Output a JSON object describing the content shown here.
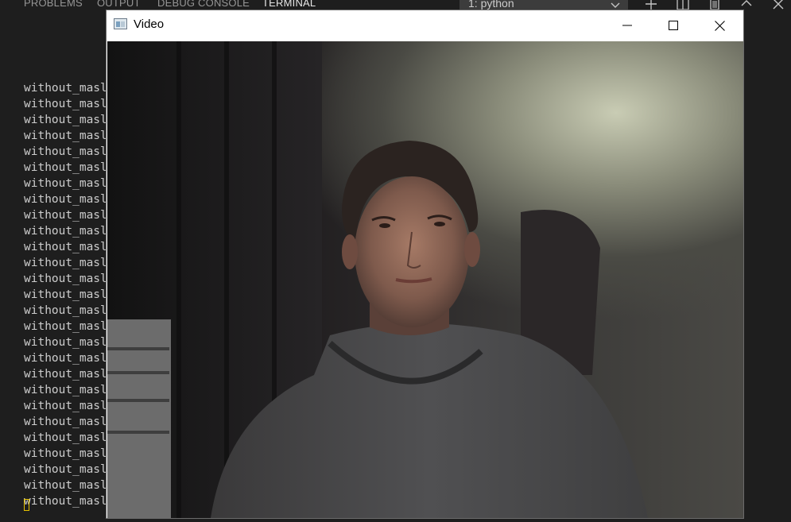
{
  "panel": {
    "tabs": [
      {
        "label": "PROBLEMS"
      },
      {
        "label": "OUTPUT"
      },
      {
        "label": "DEBUG CONSOLE"
      },
      {
        "label": "TERMINAL"
      }
    ],
    "terminal_select": "1: python"
  },
  "terminal": {
    "lines": [
      "without_masl",
      "without_masl",
      "without_masl",
      "without_masl",
      "without_masl",
      "without_masl",
      "without_masl",
      "without_masl",
      "without_masl",
      "without_masl",
      "without_masl",
      "without_masl",
      "without_masl",
      "without_masl",
      "without_masl",
      "without_masl",
      "without_masl",
      "without_masl",
      "without_masl",
      "without_masl",
      "without_masl",
      "without_masl",
      "without_masl",
      "without_masl",
      "without_masl",
      "without_masl",
      "without_masl"
    ]
  },
  "window": {
    "title": "Video"
  },
  "icons": {
    "add": "plus-icon",
    "split": "split-icon",
    "trash": "trash-icon",
    "maximize_panel": "chevron-up-icon",
    "close_panel": "close-icon"
  }
}
